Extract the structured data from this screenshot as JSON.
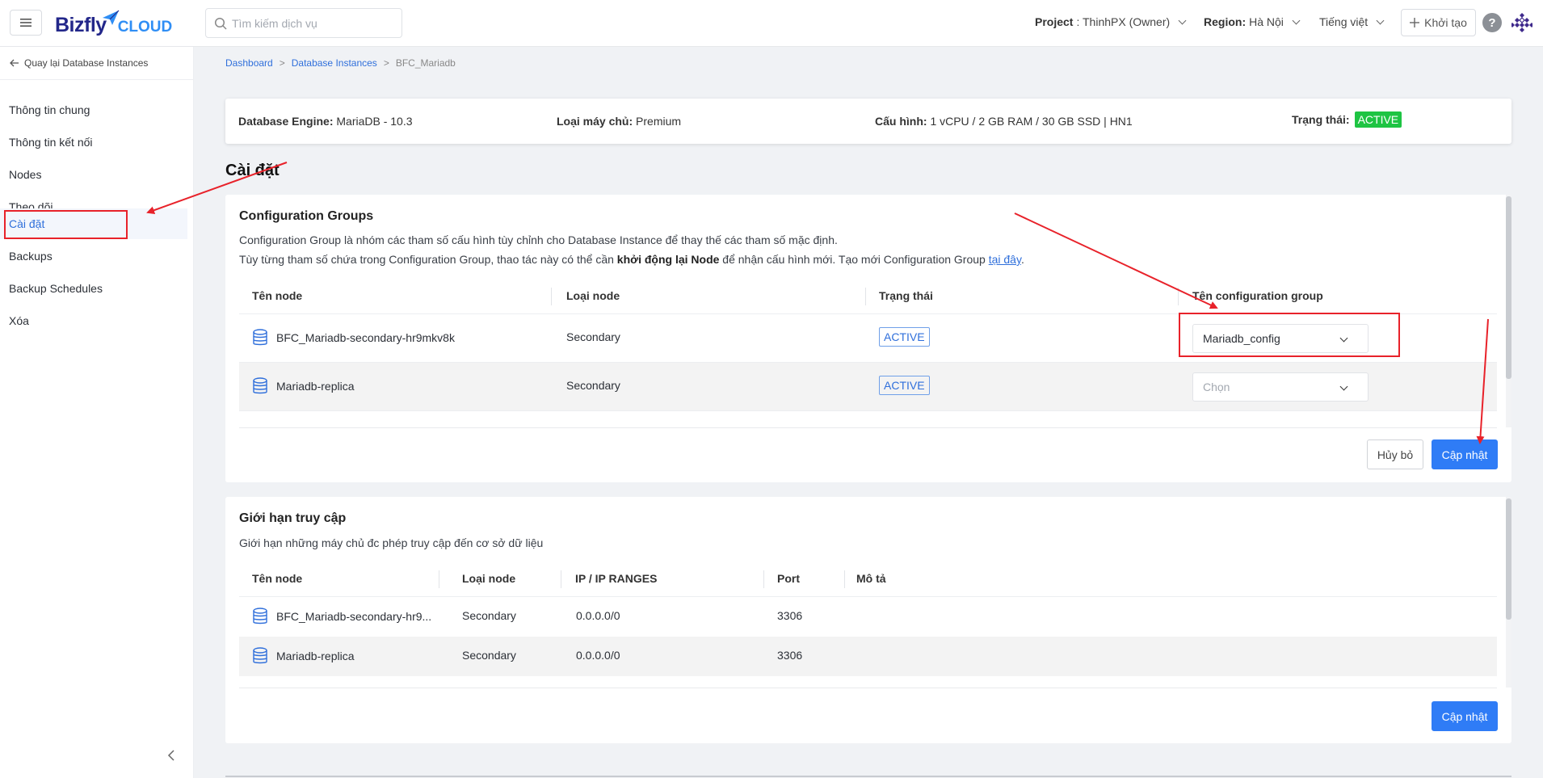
{
  "header": {
    "logo_main": "Bizfly",
    "logo_sub": "CLOUD",
    "search_placeholder": "Tìm kiếm dịch vụ",
    "project_label": "Project",
    "project_value": ": ThinhPX (Owner)",
    "region_label": "Region:",
    "region_value": "Hà Nội",
    "language": "Tiếng việt",
    "create_label": "Khởi tạo"
  },
  "sidebar": {
    "back_label": "Quay lại Database Instances",
    "items": [
      {
        "label": "Thông tin chung"
      },
      {
        "label": "Thông tin kết nối"
      },
      {
        "label": "Nodes"
      },
      {
        "label": "Theo dõi"
      },
      {
        "label": "Cài đặt"
      },
      {
        "label": "Backups"
      },
      {
        "label": "Backup Schedules"
      },
      {
        "label": "Xóa"
      }
    ],
    "active_item": "Cài đặt"
  },
  "breadcrumb": {
    "items": [
      "Dashboard",
      "Database Instances",
      "BFC_Mariadb"
    ],
    "separator": ">"
  },
  "info": {
    "engine_label": "Database Engine:",
    "engine_value": "MariaDB - 10.3",
    "server_type_label": "Loại máy chủ:",
    "server_type_value": "Premium",
    "config_label": "Cấu hình:",
    "config_value": "1 vCPU / 2 GB RAM / 30 GB SSD | HN1",
    "status_label": "Trạng thái:",
    "status_value": "ACTIVE"
  },
  "page_title": "Cài đặt",
  "config_groups": {
    "title": "Configuration Groups",
    "desc_line1": "Configuration Group là nhóm các tham số cấu hình tùy chỉnh cho Database Instance để thay thế các tham số mặc định.",
    "desc_line2_pre": "Tùy từng tham số chứa trong Configuration Group, thao tác này có thể cần ",
    "desc_line2_bold": "khởi động lại Node",
    "desc_line2_mid": " để nhận cấu hình mới. Tạo mới Configuration Group ",
    "desc_line2_link": "tại đây",
    "desc_line2_end": ".",
    "columns": [
      "Tên node",
      "Loại node",
      "Trạng thái",
      "Tên configuration group"
    ],
    "rows": [
      {
        "name": "BFC_Mariadb-secondary-hr9mkv8k",
        "type": "Secondary",
        "status": "ACTIVE",
        "group": "Mariadb_config"
      },
      {
        "name": "Mariadb-replica",
        "type": "Secondary",
        "status": "ACTIVE",
        "group": "Chọn"
      }
    ],
    "cancel_label": "Hủy bỏ",
    "update_label": "Cập nhật"
  },
  "access_limit": {
    "title": "Giới hạn truy cập",
    "desc": "Giới hạn những máy chủ đc phép truy cập đến cơ sở dữ liệu",
    "columns": [
      "Tên node",
      "Loại node",
      "IP / IP RANGES",
      "Port",
      "Mô tả"
    ],
    "rows": [
      {
        "name": "BFC_Mariadb-secondary-hr9...",
        "type": "Secondary",
        "ip": "0.0.0.0/0",
        "port": "3306",
        "desc": ""
      },
      {
        "name": "Mariadb-replica",
        "type": "Secondary",
        "ip": "0.0.0.0/0",
        "port": "3306",
        "desc": ""
      }
    ],
    "update_label": "Cập nhật"
  },
  "colors": {
    "primary": "#2f7cf6",
    "active_green": "#1ec443",
    "annotation_red": "#e8222a",
    "logo_navy": "#23278a"
  }
}
